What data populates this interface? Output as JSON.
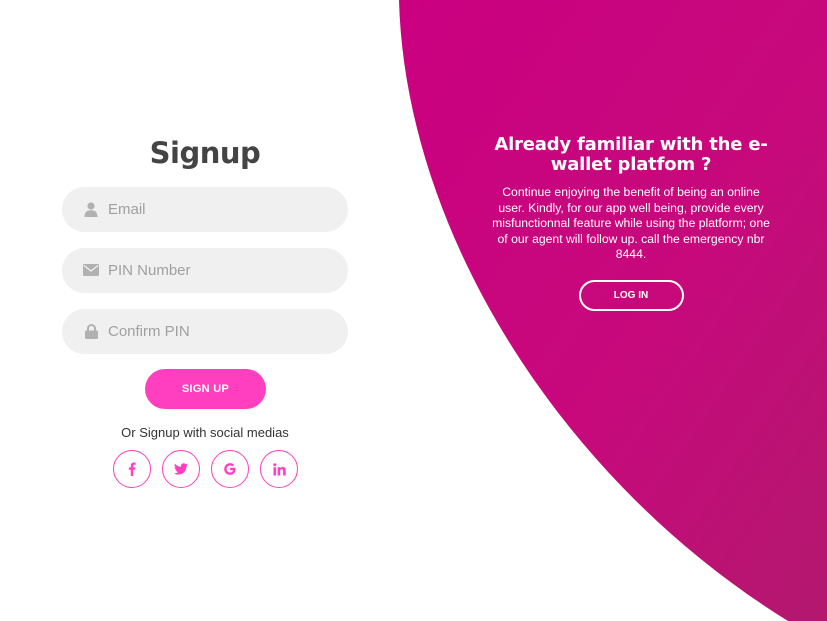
{
  "colors": {
    "accent": "#ff3fbf",
    "panel_gradient_start": "#c8007e",
    "panel_gradient_end": "#b5176f",
    "input_bg": "#f0f0f0",
    "title": "#444444"
  },
  "signup": {
    "title": "Signup",
    "fields": [
      {
        "icon": "user-icon",
        "placeholder": "Email",
        "value": ""
      },
      {
        "icon": "envelope-icon",
        "placeholder": "PIN Number",
        "value": ""
      },
      {
        "icon": "lock-icon",
        "placeholder": "Confirm PIN",
        "value": ""
      }
    ],
    "submit_label": "SIGN UP",
    "social_text": "Or Signup with social medias",
    "social": [
      {
        "icon": "facebook-icon",
        "label": "f"
      },
      {
        "icon": "twitter-icon",
        "label": "twitter"
      },
      {
        "icon": "google-icon",
        "label": "G"
      },
      {
        "icon": "linkedin-icon",
        "label": "in"
      }
    ]
  },
  "info": {
    "title": "Already familiar with the e-wallet platfom ?",
    "text": "Continue enjoying the benefit of being an online user. Kindly, for our app well being, provide every misfunctionnal feature while using the platform; one of our agent will follow up. call the emergency nbr 8444.",
    "login_label": "LOG IN"
  }
}
